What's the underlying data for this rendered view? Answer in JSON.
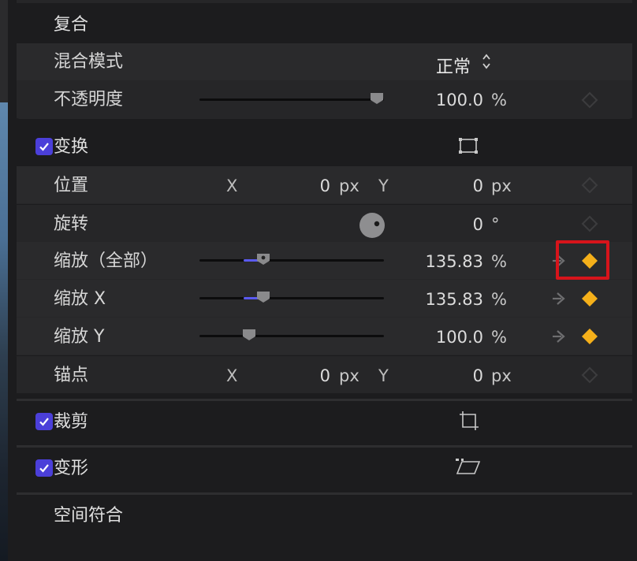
{
  "sections": {
    "composite": {
      "title": "复合",
      "blend_mode": {
        "label": "混合模式",
        "value": "正常"
      },
      "opacity": {
        "label": "不透明度",
        "value": "100.0",
        "unit": "%",
        "slider_fraction": 1.0
      }
    },
    "transform": {
      "title": "变换",
      "enabled": true,
      "position": {
        "label": "位置",
        "x_label": "X",
        "x_value": "0",
        "x_unit": "px",
        "y_label": "Y",
        "y_value": "0",
        "y_unit": "px"
      },
      "rotation": {
        "label": "旋转",
        "value": "0",
        "unit": "°"
      },
      "scale_all": {
        "label": "缩放（全部）",
        "value": "135.83",
        "unit": "%",
        "slider_fraction": 0.35,
        "keyframed": true
      },
      "scale_x": {
        "label": "缩放 X",
        "value": "135.83",
        "unit": "%",
        "slider_fraction": 0.35,
        "keyframed": true
      },
      "scale_y": {
        "label": "缩放 Y",
        "value": "100.0",
        "unit": "%",
        "slider_fraction": 0.27,
        "keyframed": true
      },
      "anchor": {
        "label": "锚点",
        "x_label": "X",
        "x_value": "0",
        "x_unit": "px",
        "y_label": "Y",
        "y_value": "0",
        "y_unit": "px"
      }
    },
    "crop": {
      "title": "裁剪",
      "enabled": true
    },
    "distort": {
      "title": "变形",
      "enabled": true
    },
    "spatial_conform": {
      "title": "空间符合"
    }
  },
  "colors": {
    "accent": "#4b3fd9",
    "keyframe_active": "#f5b01a",
    "highlight": "#d7141b"
  },
  "icons": [
    "check-icon",
    "transform-onscreen-icon",
    "crop-onscreen-icon",
    "distort-onscreen-icon",
    "keyframe-diamond-icon",
    "keyframe-nav-arrow-icon",
    "rotation-dial-icon",
    "updown-chevron-icon"
  ]
}
